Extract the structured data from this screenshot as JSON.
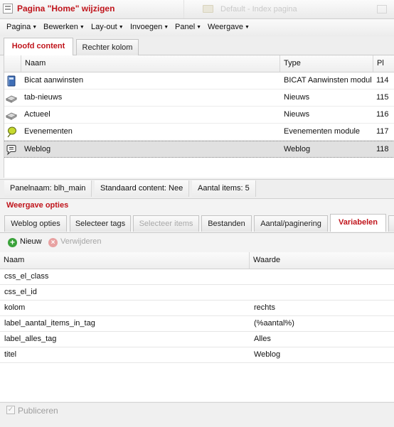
{
  "window": {
    "title": "Pagina \"Home\" wijzigen",
    "background_title": "Default - Index pagina"
  },
  "menu": [
    {
      "label": "Pagina"
    },
    {
      "label": "Bewerken"
    },
    {
      "label": "Lay-out"
    },
    {
      "label": "Invoegen"
    },
    {
      "label": "Panel"
    },
    {
      "label": "Weergave"
    }
  ],
  "top_tabs": [
    {
      "label": "Hoofd content",
      "active": true
    },
    {
      "label": "Rechter kolom",
      "active": false
    }
  ],
  "content_grid": {
    "columns": [
      "Naam",
      "Type",
      "Pl"
    ],
    "rows": [
      {
        "icon": "book-icon",
        "naam": "Bicat aanwinsten",
        "type": "BICAT Aanwinsten module",
        "pl": "114"
      },
      {
        "icon": "news-icon",
        "naam": "tab-nieuws",
        "type": "Nieuws",
        "pl": "115"
      },
      {
        "icon": "news-icon",
        "naam": "Actueel",
        "type": "Nieuws",
        "pl": "116"
      },
      {
        "icon": "event-balloon-icon",
        "naam": "Evenementen",
        "type": "Evenementen module",
        "pl": "117"
      },
      {
        "icon": "speech-bubble-icon",
        "naam": "Weblog",
        "type": "Weblog",
        "pl": "118",
        "selected": true
      }
    ]
  },
  "status": {
    "panelnaam": "Panelnaam: blh_main",
    "standaard_content": "Standaard content: Nee",
    "aantal_items": "Aantal items: 5"
  },
  "section_title": "Weergave opties",
  "sub_tabs": [
    {
      "label": "Weblog opties"
    },
    {
      "label": "Selecteer tags"
    },
    {
      "label": "Selecteer items",
      "disabled": true
    },
    {
      "label": "Bestanden"
    },
    {
      "label": "Aantal/paginering"
    },
    {
      "label": "Variabelen",
      "active": true
    }
  ],
  "toolbar": {
    "new_label": "Nieuw",
    "delete_label": "Verwijderen"
  },
  "variables_grid": {
    "columns": [
      "Naam",
      "Waarde"
    ],
    "rows": [
      {
        "naam": "css_el_class",
        "waarde": ""
      },
      {
        "naam": "css_el_id",
        "waarde": ""
      },
      {
        "naam": "kolom",
        "waarde": "rechts"
      },
      {
        "naam": "label_aantal_items_in_tag",
        "waarde": "(%aantal%)"
      },
      {
        "naam": "label_alles_tag",
        "waarde": "Alles"
      },
      {
        "naam": "titel",
        "waarde": "Weblog"
      }
    ]
  },
  "footer": {
    "publish_label": "Publiceren",
    "publish_checked": true
  },
  "colors": {
    "accent_red": "#c0141b",
    "add_green": "#3aa23a",
    "delete_red": "#e29b9b"
  }
}
